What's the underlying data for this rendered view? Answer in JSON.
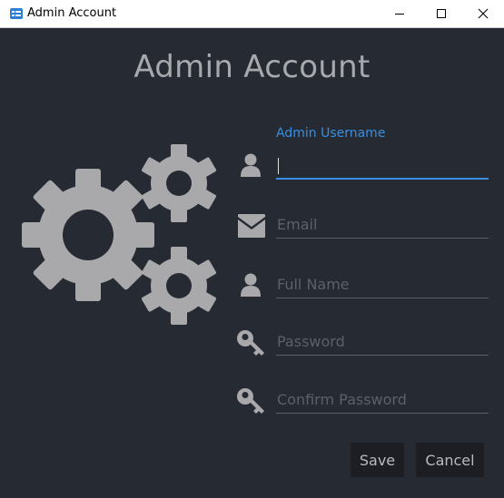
{
  "window": {
    "title": "Admin Account",
    "controls": {
      "minimize_icon": "minimize-icon",
      "maximize_icon": "maximize-icon",
      "close_icon": "close-icon"
    }
  },
  "heading": "Admin Account",
  "illustration": {
    "icon": "gears-icon"
  },
  "form": {
    "fields": [
      {
        "label": "Admin Username",
        "value": "",
        "placeholder": "",
        "icon": "user-icon",
        "focused": true
      },
      {
        "label": "Email",
        "value": "",
        "placeholder": "Email",
        "icon": "envelope-icon"
      },
      {
        "label": "Full Name",
        "value": "",
        "placeholder": "Full Name",
        "icon": "user-icon"
      },
      {
        "label": "Password",
        "value": "",
        "placeholder": "Password",
        "icon": "key-icon"
      },
      {
        "label": "Confirm Password",
        "value": "",
        "placeholder": "Confirm Password",
        "icon": "key-icon"
      }
    ]
  },
  "buttons": {
    "save": "Save",
    "cancel": "Cancel"
  },
  "colors": {
    "background": "#262a33",
    "accent": "#3a8fe0",
    "icon_gray": "#a9a9ac",
    "button_bg": "#1c1e23"
  }
}
